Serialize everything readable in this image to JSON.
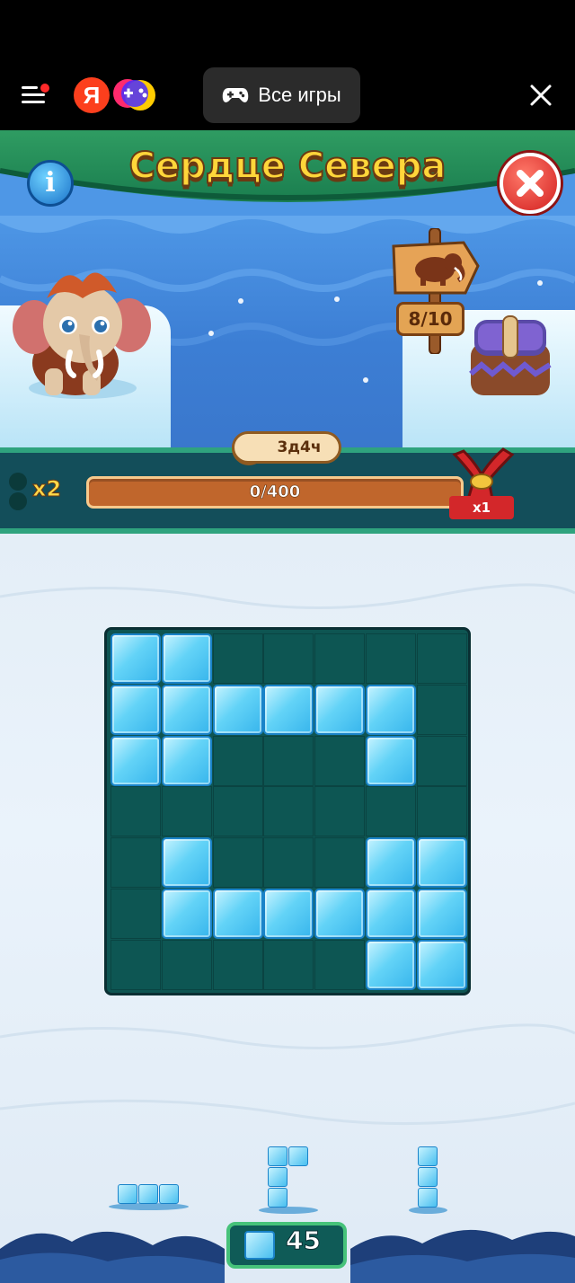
{
  "browser": {
    "all_games_label": "Все игры",
    "yandex_logo_letter": "Я",
    "icons": [
      "menu-icon",
      "yandex-logo",
      "yandex-games-logo",
      "gamepad-icon",
      "close-icon"
    ]
  },
  "header": {
    "title": "Сердце Севера",
    "info_label": "i",
    "colors": {
      "title": "#ffd63a",
      "header_band": "#1f8453",
      "quit": "#d21f1f"
    }
  },
  "scene": {
    "level_progress": "8/10",
    "signpost_icon": "mammoth-icon",
    "character": "baby-mammoth",
    "reward": "treasure-chest"
  },
  "progress": {
    "timer": "3д4ч",
    "multiplier": "x2",
    "points": "0/400",
    "fill_fraction": 0,
    "booster_icon": "slingshot-icon",
    "booster_count": "x1"
  },
  "board": {
    "rows": 7,
    "cols": 7,
    "cells": [
      [
        1,
        1,
        0,
        0,
        0,
        0,
        0
      ],
      [
        1,
        1,
        1,
        1,
        1,
        1,
        0
      ],
      [
        1,
        1,
        0,
        0,
        0,
        1,
        0
      ],
      [
        0,
        0,
        0,
        0,
        0,
        0,
        0
      ],
      [
        0,
        1,
        0,
        0,
        0,
        1,
        1
      ],
      [
        0,
        1,
        1,
        1,
        1,
        1,
        1
      ],
      [
        0,
        0,
        0,
        0,
        0,
        1,
        1
      ]
    ]
  },
  "pieces": [
    {
      "name": "horizontal-3",
      "blocks": [
        [
          0,
          0
        ],
        [
          0,
          1
        ],
        [
          0,
          2
        ]
      ]
    },
    {
      "name": "l-shape",
      "blocks": [
        [
          0,
          0
        ],
        [
          0,
          1
        ],
        [
          1,
          0
        ],
        [
          2,
          0
        ]
      ]
    },
    {
      "name": "vertical-3",
      "blocks": [
        [
          0,
          0
        ],
        [
          1,
          0
        ],
        [
          2,
          0
        ]
      ]
    }
  ],
  "ice_counter": "45"
}
